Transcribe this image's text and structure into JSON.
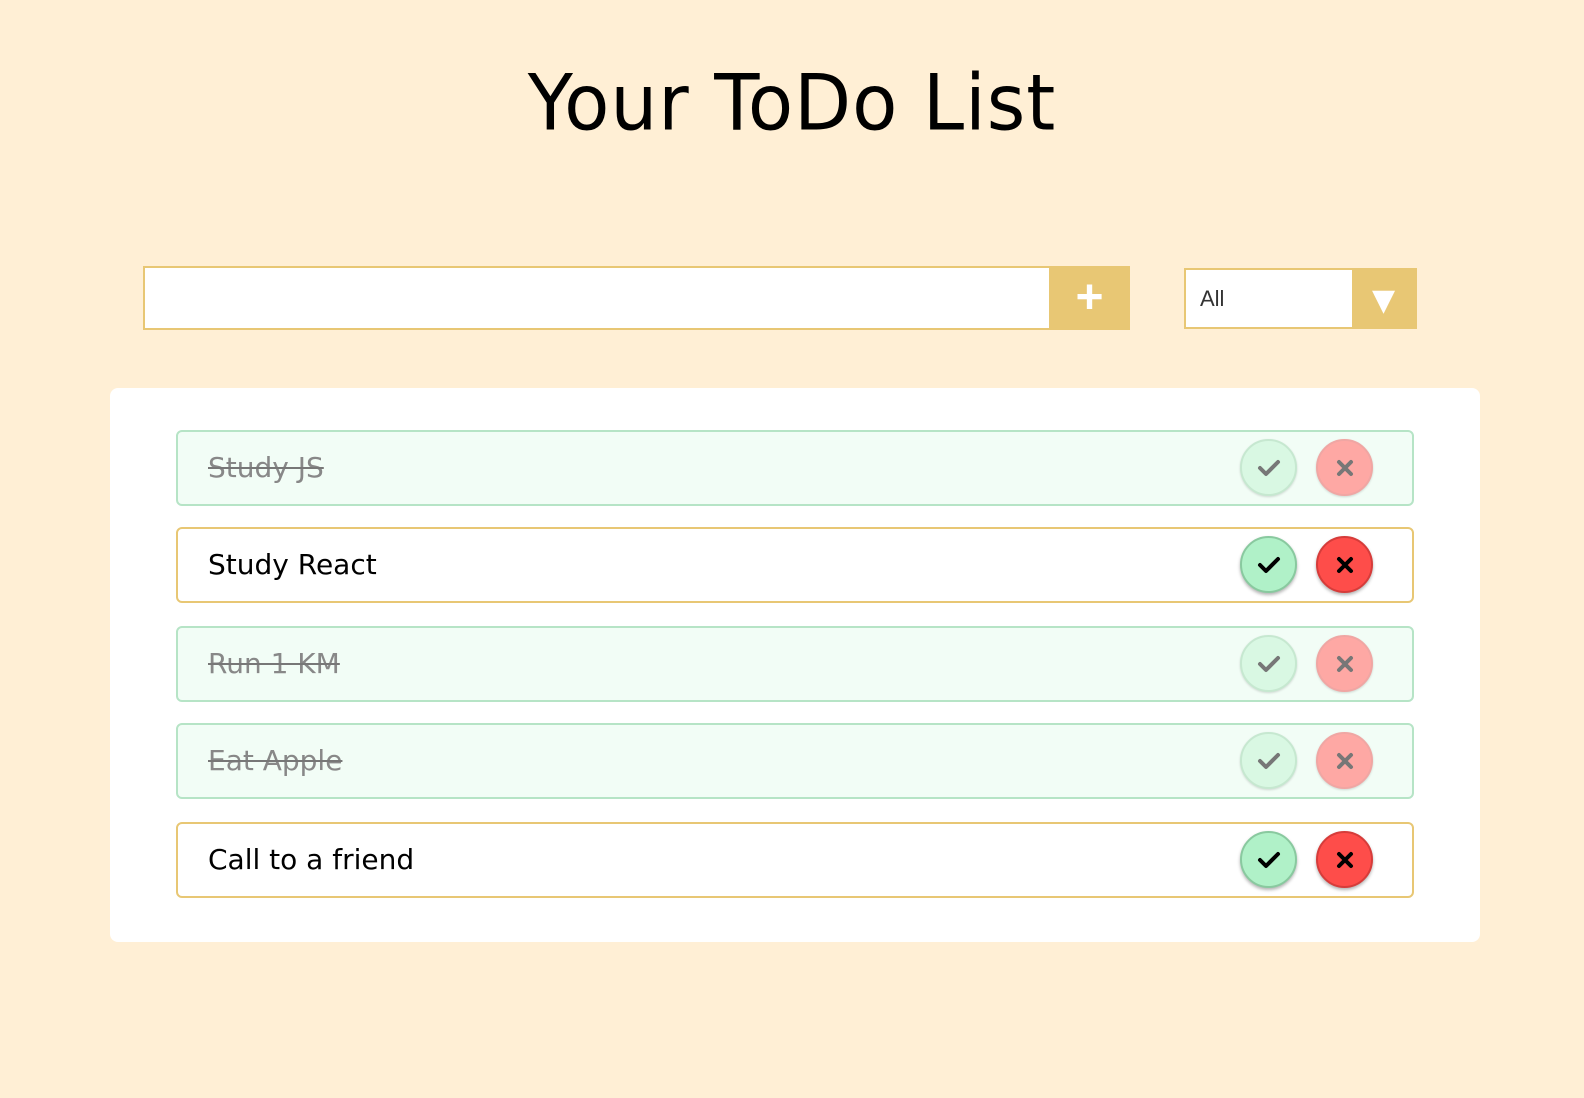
{
  "header": {
    "title": "Your ToDo List"
  },
  "add_form": {
    "input_value": "",
    "input_placeholder": "",
    "add_button_label": "+"
  },
  "filter": {
    "selected": "All",
    "arrow_icon": "triangle-down-icon"
  },
  "colors": {
    "background": "#ffefd5",
    "accent": "#e8c774",
    "complete": "#b0f1c8",
    "delete": "#fe4d4a"
  },
  "todos": [
    {
      "text": "Study JS",
      "completed": true
    },
    {
      "text": "Study React",
      "completed": false
    },
    {
      "text": "Run 1 KM",
      "completed": true
    },
    {
      "text": "Eat Apple",
      "completed": true
    },
    {
      "text": "Call to a friend",
      "completed": false
    }
  ]
}
